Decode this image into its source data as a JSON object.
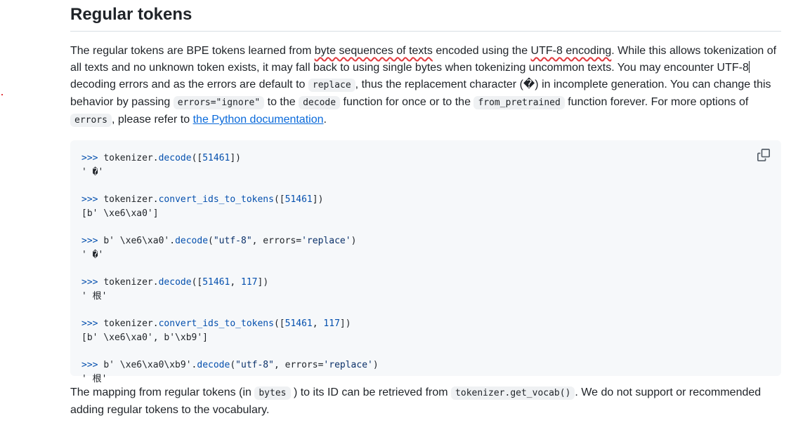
{
  "section": {
    "heading": "Regular tokens"
  },
  "intro": {
    "t1": "The regular tokens are BPE tokens learned from",
    "u1": "byte sequences of texts",
    "t2": "encoded using the",
    "u2": "UTF-8 encoding",
    "t3": ". While this allows tokenization of all texts and no unknown token exists, it may fall back to using single bytes when tokenizing uncommon texts. You may encounter UTF-8",
    "t4": "decoding errors and as the errors are default to",
    "c1": "replace",
    "t5": ", thus the replacement character (�) in incomplete generation. You can change this behavior by passing",
    "c2": "errors=\"ignore\"",
    "t6": "to the",
    "c3": "decode",
    "t7": "function for once or to the",
    "c4": "from_pretrained",
    "t8": "function forever. For more options of",
    "c5": "errors",
    "t9": ", please refer to",
    "link": "the Python documentation",
    "t10": "."
  },
  "code_block": {
    "prompt": ">>>",
    "examples": [
      {
        "obj": "tokenizer.",
        "fn": "decode",
        "open": "([",
        "nums": "51461",
        "close": "])",
        "out": "' �'"
      },
      {
        "obj": "tokenizer.",
        "fn": "convert_ids_to_tokens",
        "open": "([",
        "nums": "51461",
        "close": "])",
        "out": "[b' \\xe6\\xa0']"
      },
      {
        "obj": "b' \\xe6\\xa0'.",
        "fn": "decode",
        "arg1": "\"utf-8\"",
        "kw": ", errors=",
        "arg2": "'replace'",
        "close": ")",
        "out": "' �'"
      },
      {
        "obj": "tokenizer.",
        "fn": "decode",
        "open": "([",
        "n1": "51461",
        "sep": ", ",
        "n2": "117",
        "close": "])",
        "out": "' 根'"
      },
      {
        "obj": "tokenizer.",
        "fn": "convert_ids_to_tokens",
        "open": "([",
        "n1": "51461",
        "sep": ", ",
        "n2": "117",
        "close": "])",
        "out": "[b' \\xe6\\xa0', b'\\xb9']"
      },
      {
        "obj": "b' \\xe6\\xa0\\xb9'.",
        "fn": "decode",
        "arg1": "\"utf-8\"",
        "kw": ", errors=",
        "arg2": "'replace'",
        "close": ")",
        "out": "' 根'"
      }
    ]
  },
  "mapping": {
    "t1": "The mapping from regular tokens (in",
    "c1": "bytes",
    "t2": ") to its ID can be retrieved from",
    "c2": "tokenizer.get_vocab()",
    "t3": ". We do not support or recommended adding regular tokens to the vocabulary."
  },
  "icons": {
    "copy": "copy-icon"
  },
  "colors": {
    "link": "#0969da",
    "underline": "#e0393e",
    "code_bg": "#f6f8fa"
  }
}
